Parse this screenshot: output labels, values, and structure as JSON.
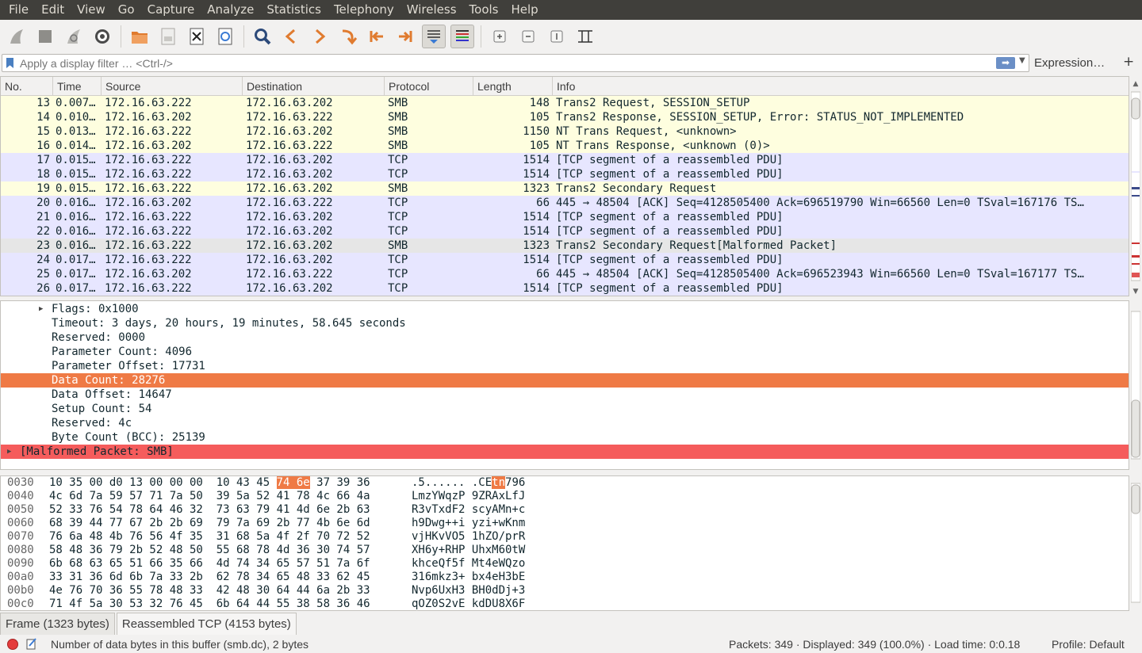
{
  "menu": [
    "File",
    "Edit",
    "View",
    "Go",
    "Capture",
    "Analyze",
    "Statistics",
    "Telephony",
    "Wireless",
    "Tools",
    "Help"
  ],
  "toolbar_icons": [
    "shark-fin-start-icon",
    "stop-square-icon",
    "shark-fin-restart-icon",
    "gear-options-icon",
    "open-folder-icon",
    "file-save-icon",
    "close-file-icon",
    "reload-icon",
    "magnifier-search-icon",
    "arrow-left-icon",
    "arrow-right-icon",
    "go-to-packet-icon",
    "first-packet-icon",
    "last-packet-icon",
    "autoscroll-icon",
    "colorize-icon",
    "zoom-in-icon",
    "zoom-out-icon",
    "zoom-normal-icon",
    "resize-columns-icon"
  ],
  "filter": {
    "placeholder": "Apply a display filter … <Ctrl-/>",
    "expression_label": "Expression…",
    "add_label": "+"
  },
  "columns": [
    "No.",
    "Time",
    "Source",
    "Destination",
    "Protocol",
    "Length",
    "Info"
  ],
  "packets": [
    {
      "no": "13",
      "time": "0.007…",
      "src": "172.16.63.222",
      "dst": "172.16.63.202",
      "proto": "SMB",
      "len": "148",
      "info": "Trans2 Request, SESSION_SETUP",
      "cls": "smb"
    },
    {
      "no": "14",
      "time": "0.010…",
      "src": "172.16.63.202",
      "dst": "172.16.63.222",
      "proto": "SMB",
      "len": "105",
      "info": "Trans2 Response, SESSION_SETUP, Error: STATUS_NOT_IMPLEMENTED",
      "cls": "smb"
    },
    {
      "no": "15",
      "time": "0.013…",
      "src": "172.16.63.222",
      "dst": "172.16.63.202",
      "proto": "SMB",
      "len": "1150",
      "info": "NT Trans Request, <unknown>",
      "cls": "smb"
    },
    {
      "no": "16",
      "time": "0.014…",
      "src": "172.16.63.202",
      "dst": "172.16.63.222",
      "proto": "SMB",
      "len": "105",
      "info": "NT Trans Response, <unknown (0)>",
      "cls": "smb"
    },
    {
      "no": "17",
      "time": "0.015…",
      "src": "172.16.63.222",
      "dst": "172.16.63.202",
      "proto": "TCP",
      "len": "1514",
      "info": "[TCP segment of a reassembled PDU]",
      "cls": "tcp"
    },
    {
      "no": "18",
      "time": "0.015…",
      "src": "172.16.63.222",
      "dst": "172.16.63.202",
      "proto": "TCP",
      "len": "1514",
      "info": "[TCP segment of a reassembled PDU]",
      "cls": "tcp"
    },
    {
      "no": "19",
      "time": "0.015…",
      "src": "172.16.63.222",
      "dst": "172.16.63.202",
      "proto": "SMB",
      "len": "1323",
      "info": "Trans2 Secondary Request",
      "cls": "smb"
    },
    {
      "no": "20",
      "time": "0.016…",
      "src": "172.16.63.202",
      "dst": "172.16.63.222",
      "proto": "TCP",
      "len": "66",
      "info": "445 → 48504 [ACK] Seq=4128505400 Ack=696519790 Win=66560 Len=0 TSval=167176 TS…",
      "cls": "tcp"
    },
    {
      "no": "21",
      "time": "0.016…",
      "src": "172.16.63.222",
      "dst": "172.16.63.202",
      "proto": "TCP",
      "len": "1514",
      "info": "[TCP segment of a reassembled PDU]",
      "cls": "tcp"
    },
    {
      "no": "22",
      "time": "0.016…",
      "src": "172.16.63.222",
      "dst": "172.16.63.202",
      "proto": "TCP",
      "len": "1514",
      "info": "[TCP segment of a reassembled PDU]",
      "cls": "tcp"
    },
    {
      "no": "23",
      "time": "0.016…",
      "src": "172.16.63.222",
      "dst": "172.16.63.202",
      "proto": "SMB",
      "len": "1323",
      "info": "Trans2 Secondary Request[Malformed Packet]",
      "cls": "sel"
    },
    {
      "no": "24",
      "time": "0.017…",
      "src": "172.16.63.222",
      "dst": "172.16.63.202",
      "proto": "TCP",
      "len": "1514",
      "info": "[TCP segment of a reassembled PDU]",
      "cls": "tcp"
    },
    {
      "no": "25",
      "time": "0.017…",
      "src": "172.16.63.202",
      "dst": "172.16.63.222",
      "proto": "TCP",
      "len": "66",
      "info": "445 → 48504 [ACK] Seq=4128505400 Ack=696523943 Win=66560 Len=0 TSval=167177 TS…",
      "cls": "tcp"
    },
    {
      "no": "26",
      "time": "0.017…",
      "src": "172.16.63.222",
      "dst": "172.16.63.202",
      "proto": "TCP",
      "len": "1514",
      "info": "[TCP segment of a reassembled PDU]",
      "cls": "tcp"
    }
  ],
  "details": [
    {
      "text": "Flags: 0x1000",
      "expander": true,
      "cls": ""
    },
    {
      "text": "Timeout: 3 days, 20 hours, 19 minutes, 58.645 seconds",
      "cls": ""
    },
    {
      "text": "Reserved: 0000",
      "cls": ""
    },
    {
      "text": "Parameter Count: 4096",
      "cls": ""
    },
    {
      "text": "Parameter Offset: 17731",
      "cls": ""
    },
    {
      "text": "Data Count: 28276",
      "cls": "hl"
    },
    {
      "text": "Data Offset: 14647",
      "cls": ""
    },
    {
      "text": "Setup Count: 54",
      "cls": ""
    },
    {
      "text": "Reserved: 4c",
      "cls": ""
    },
    {
      "text": "Byte Count (BCC): 25139",
      "cls": ""
    },
    {
      "text": "[Malformed Packet: SMB]",
      "expander": true,
      "cls": "mal"
    }
  ],
  "bytes": [
    {
      "off": "0030",
      "hex_a": "10 35 00 d0 13 00 00 00  10 43 45 ",
      "hex_hl": "74 6e",
      "hex_b": " 37 39 36",
      "asc_a": ".5...... .CE",
      "asc_hl": "tn",
      "asc_b": "796"
    },
    {
      "off": "0040",
      "hex_a": "4c 6d 7a 59 57 71 7a 50  39 5a 52 41 78 4c 66 4a",
      "asc_a": "LmzYWqzP 9ZRAxLfJ"
    },
    {
      "off": "0050",
      "hex_a": "52 33 76 54 78 64 46 32  73 63 79 41 4d 6e 2b 63",
      "asc_a": "R3vTxdF2 scyAMn+c"
    },
    {
      "off": "0060",
      "hex_a": "68 39 44 77 67 2b 2b 69  79 7a 69 2b 77 4b 6e 6d",
      "asc_a": "h9Dwg++i yzi+wKnm"
    },
    {
      "off": "0070",
      "hex_a": "76 6a 48 4b 76 56 4f 35  31 68 5a 4f 2f 70 72 52",
      "asc_a": "vjHKvVO5 1hZO/prR"
    },
    {
      "off": "0080",
      "hex_a": "58 48 36 79 2b 52 48 50  55 68 78 4d 36 30 74 57",
      "asc_a": "XH6y+RHP UhxM60tW"
    },
    {
      "off": "0090",
      "hex_a": "6b 68 63 65 51 66 35 66  4d 74 34 65 57 51 7a 6f",
      "asc_a": "khceQf5f Mt4eWQzo"
    },
    {
      "off": "00a0",
      "hex_a": "33 31 36 6d 6b 7a 33 2b  62 78 34 65 48 33 62 45",
      "asc_a": "316mkz3+ bx4eH3bE"
    },
    {
      "off": "00b0",
      "hex_a": "4e 76 70 36 55 78 48 33  42 48 30 64 44 6a 2b 33",
      "asc_a": "Nvp6UxH3 BH0dDj+3"
    },
    {
      "off": "00c0",
      "hex_a": "71 4f 5a 30 53 32 76 45  6b 64 44 55 38 58 36 46",
      "asc_a": "qOZ0S2vE kdDU8X6F"
    }
  ],
  "tabs": [
    "Frame (1323 bytes)",
    "Reassembled TCP (4153 bytes)"
  ],
  "status": {
    "message": "Number of data bytes in this buffer (smb.dc), 2 bytes",
    "packets": "Packets: 349 · Displayed: 349 (100.0%) · Load time: 0:0.18",
    "profile": "Profile: Default"
  }
}
